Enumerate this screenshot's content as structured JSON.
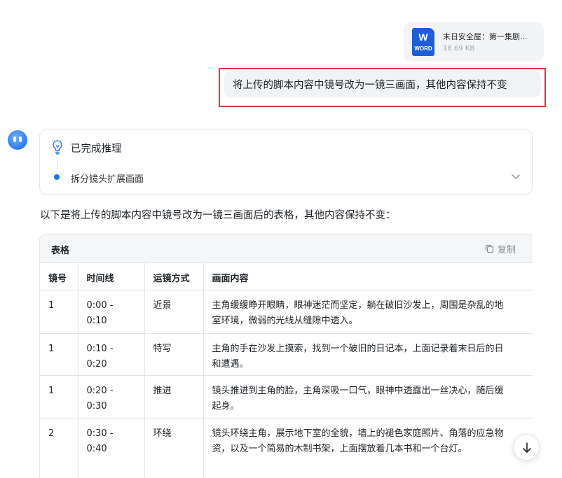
{
  "file": {
    "name": "末日安全屋：第一集剧...",
    "size": "18.69 KB",
    "icon_letter": "W",
    "icon_tag": "WORD",
    "icon": "word-document-icon"
  },
  "user_message": "将上传的脚本内容中镜号改为一镜三画面，其他内容保持不变",
  "reasoning": {
    "status": "已完成推理",
    "step": "拆分镜头扩展画面"
  },
  "intro_text": "以下是将上传的脚本内容中镜号改为一镜三画面后的表格，其他内容保持不变：",
  "table": {
    "title": "表格",
    "copy_label": "复制",
    "headers": [
      "镜号",
      "时间线",
      "运镜方式",
      "画面内容"
    ],
    "rows": [
      {
        "shot": "1",
        "time": "0:00 - 0:10",
        "camera": "近景",
        "line1": "主角缓缓睁开眼睛，眼神迷茫而坚定，躺在破旧沙发上，周围是杂乱的地",
        "line2": "室环境，微弱的光线从缝隙中透入。"
      },
      {
        "shot": "1",
        "time": "0:10 - 0:20",
        "camera": "特写",
        "line1": "主角的手在沙发上摸索，找到一个破旧的日记本，上面记录着末日后的日",
        "line2": "和遭遇。"
      },
      {
        "shot": "1",
        "time": "0:20 - 0:30",
        "camera": "推进",
        "line1": "镜头推进到主角的脸，主角深吸一口气，眼神中透露出一丝决心，随后缓",
        "line2": "起身。"
      },
      {
        "shot": "2",
        "time": "0:30 - 0:40",
        "camera": "环绕",
        "line1": "镜头环绕主角，展示地下室的全貌，墙上的褪色家庭照片、角落的应急物",
        "line2": "资，以及一个简易的木制书架，上面摆放着几本书和一个台灯。"
      }
    ]
  },
  "colors": {
    "accent": "#1f74ea",
    "highlight_border": "#e5383b",
    "word_blue": "#1e5fd8"
  }
}
